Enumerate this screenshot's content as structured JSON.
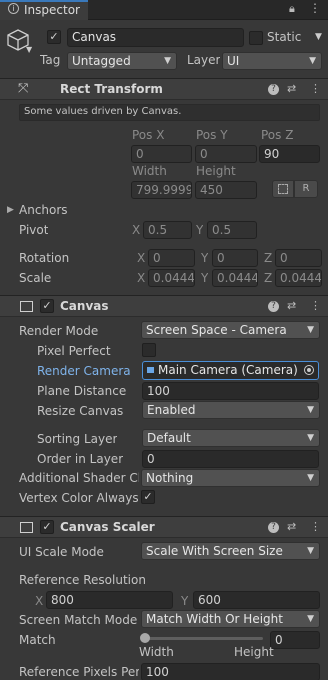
{
  "tab": {
    "title": "Inspector"
  },
  "object": {
    "name": "Canvas",
    "static_label": "Static",
    "tag_label": "Tag",
    "tag_value": "Untagged",
    "layer_label": "Layer",
    "layer_value": "UI"
  },
  "rect_transform": {
    "title": "Rect Transform",
    "note": "Some values driven by Canvas.",
    "pos_x_label": "Pos X",
    "pos_y_label": "Pos Y",
    "pos_z_label": "Pos Z",
    "pos_x": "0",
    "pos_y": "0",
    "pos_z": "90",
    "width_label": "Width",
    "height_label": "Height",
    "width": "799.9999",
    "height": "450",
    "r_button": "R",
    "anchors_label": "Anchors",
    "pivot_label": "Pivot",
    "pivot_x": "0.5",
    "pivot_y": "0.5",
    "rotation_label": "Rotation",
    "rot_x": "0",
    "rot_y": "0",
    "rot_z": "0",
    "scale_label": "Scale",
    "scale_x": "0.0444",
    "scale_y": "0.0444",
    "scale_z": "0.0444",
    "x": "X",
    "y": "Y",
    "z": "Z"
  },
  "canvas": {
    "title": "Canvas",
    "render_mode_label": "Render Mode",
    "render_mode": "Screen Space - Camera",
    "pixel_perfect_label": "Pixel Perfect",
    "render_camera_label": "Render Camera",
    "render_camera": "Main Camera (Camera)",
    "plane_distance_label": "Plane Distance",
    "plane_distance": "100",
    "resize_canvas_label": "Resize Canvas",
    "resize_canvas": "Enabled",
    "sorting_layer_label": "Sorting Layer",
    "sorting_layer": "Default",
    "order_in_layer_label": "Order in Layer",
    "order_in_layer": "0",
    "shader_channels_label": "Additional Shader Ch",
    "shader_channels": "Nothing",
    "vertex_color_label": "Vertex Color Always I"
  },
  "scaler": {
    "title": "Canvas Scaler",
    "ui_scale_mode_label": "UI Scale Mode",
    "ui_scale_mode": "Scale With Screen Size",
    "ref_res_label": "Reference Resolution",
    "ref_x": "800",
    "ref_y": "600",
    "match_mode_label": "Screen Match Mode",
    "match_mode": "Match Width Or Height",
    "match_label": "Match",
    "match_value": "0",
    "width_label": "Width",
    "height_label": "Height",
    "ref_pixels_label": "Reference Pixels Per",
    "ref_pixels": "100"
  }
}
